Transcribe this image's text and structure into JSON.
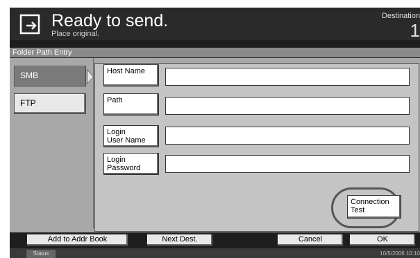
{
  "header": {
    "title": "Ready to send.",
    "subtitle": "Place original.",
    "destination_label": "Destination",
    "destination_count": "1",
    "icon": "send-original-icon"
  },
  "section": {
    "title": "Folder Path Entry"
  },
  "protocols": [
    {
      "label": "SMB",
      "selected": true
    },
    {
      "label": "FTP",
      "selected": false
    }
  ],
  "fields": [
    {
      "label": "Host Name",
      "value": ""
    },
    {
      "label": "Path",
      "value": ""
    },
    {
      "label": "Login\nUser Name",
      "value": ""
    },
    {
      "label": "Login\nPassword",
      "value": ""
    }
  ],
  "connection_test": {
    "label": "Connection\nTest"
  },
  "bottom": {
    "add_to_addr_book": "Add to Addr Book",
    "next_dest": "Next Dest.",
    "cancel": "Cancel",
    "ok": "OK"
  },
  "status": {
    "label": "Status",
    "datetime": "10/5/2006   10:10"
  },
  "colors": {
    "header_bg": "#2a2a2a",
    "panel_bg": "#a8a8a8",
    "section_bg": "#8a8a8a"
  }
}
